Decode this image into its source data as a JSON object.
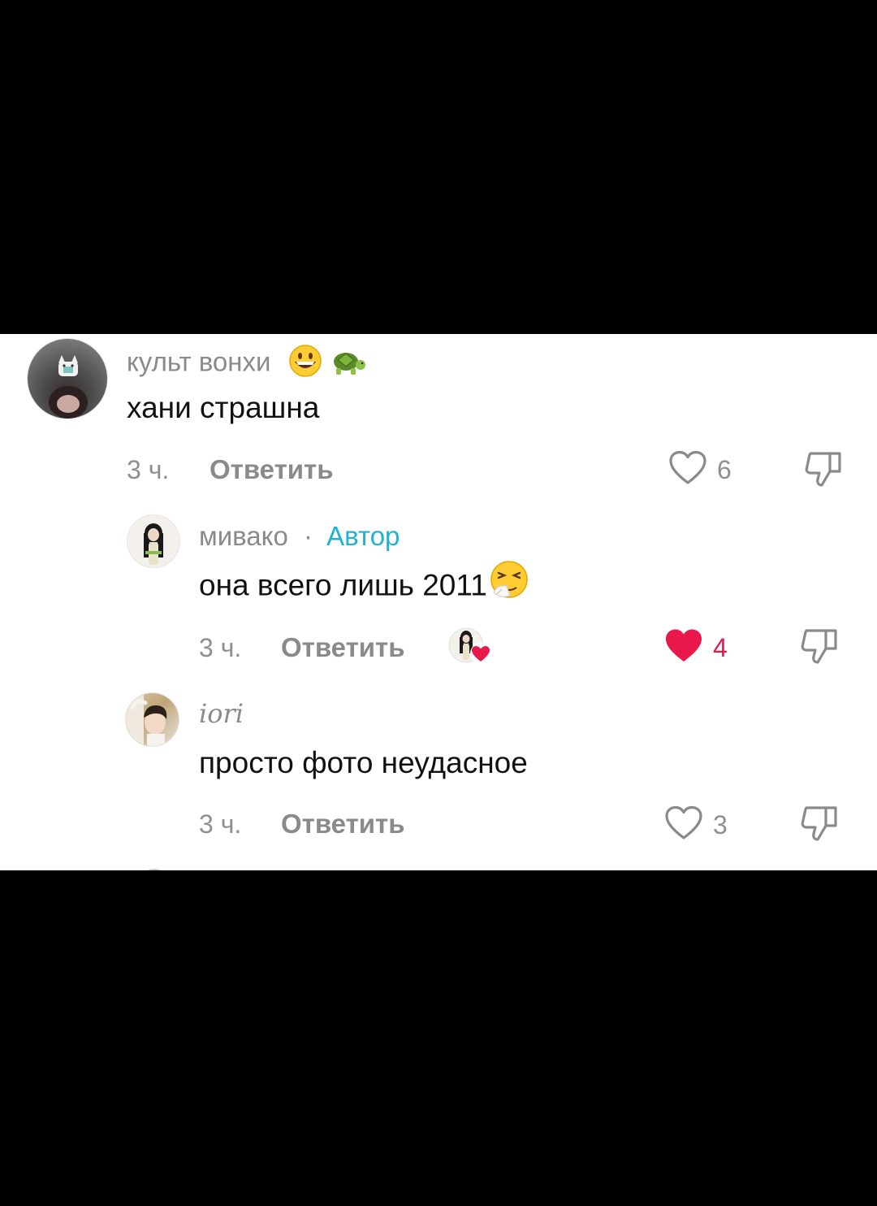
{
  "comments": [
    {
      "username": "культ вонхи",
      "username_emojis": [
        "grinning-face-emoji",
        "turtle-emoji"
      ],
      "text": "хани страшна",
      "time": "3 ч.",
      "reply_label": "Ответить",
      "likes": "6",
      "liked": false
    },
    {
      "username": "мивако",
      "separator": "·",
      "author_badge": "Автор",
      "text": "она всего лишь 2011",
      "text_emoji": "sneezing-face-emoji",
      "time": "3 ч.",
      "reply_label": "Ответить",
      "likes": "4",
      "liked": true,
      "liked_by_creator": true
    },
    {
      "username": "iori",
      "text": "просто фото неудасное",
      "time": "3 ч.",
      "reply_label": "Ответить",
      "likes": "3",
      "liked": false
    }
  ],
  "colors": {
    "background": "#000000",
    "panel": "#ffffff",
    "author_badge": "#1fb3cf",
    "liked": "#e8194a",
    "muted_text": "#8a8a8a"
  }
}
